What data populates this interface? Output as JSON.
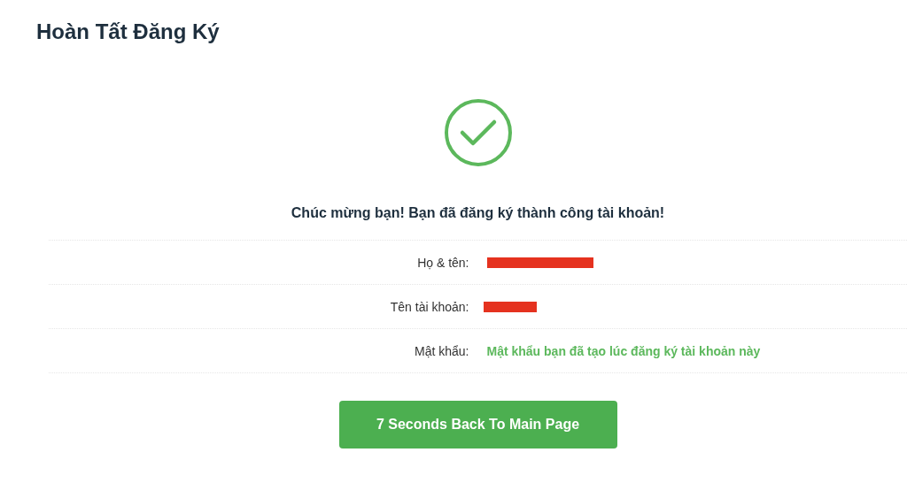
{
  "page_title": "Hoàn Tất Đăng Ký",
  "success": {
    "message": "Chúc mừng bạn! Bạn đã đăng ký thành công tài khoản!"
  },
  "details": [
    {
      "label": "Họ & tên:",
      "kind": "redacted"
    },
    {
      "label": "Tên tài khoản:",
      "kind": "redacted"
    },
    {
      "label": "Mật khẩu:",
      "kind": "text",
      "value": "Mật khẩu bạn đã tạo lúc đăng ký tài khoản này"
    }
  ],
  "button": {
    "label": "7 Seconds Back To Main Page"
  }
}
